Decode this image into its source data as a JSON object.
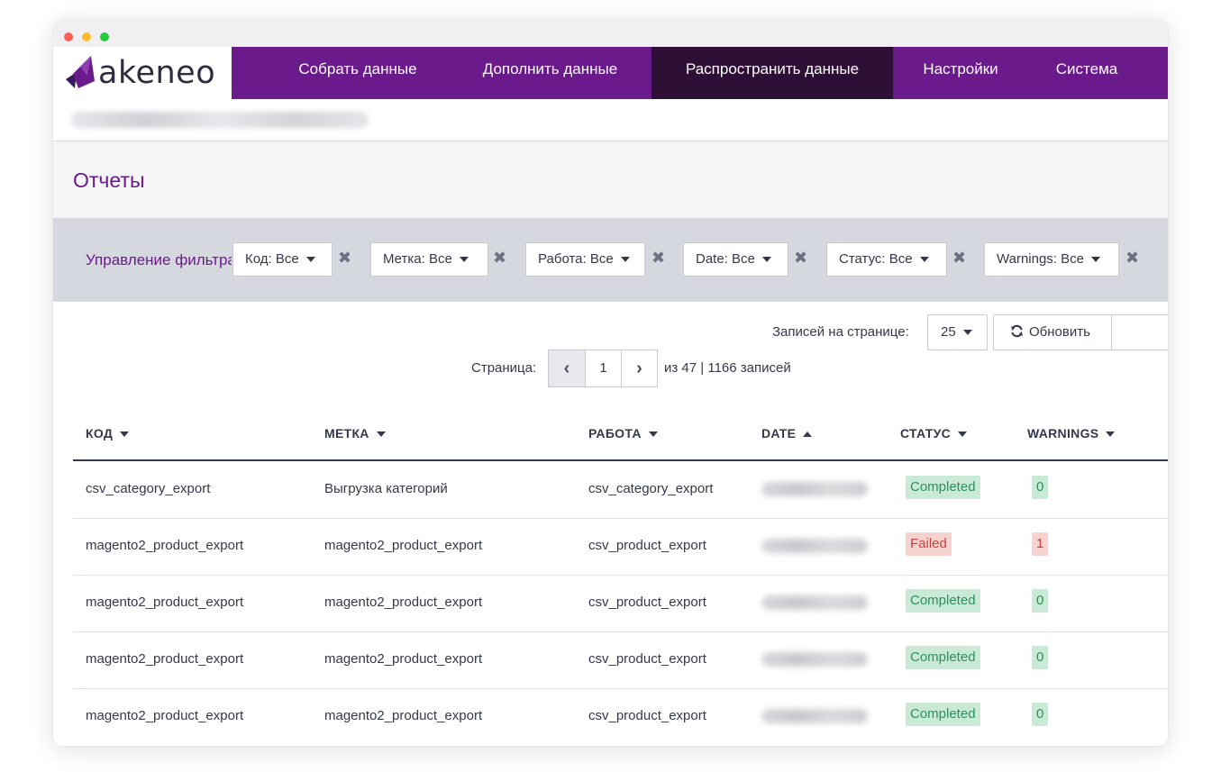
{
  "window": {
    "traffic_lights": [
      "close",
      "minimize",
      "maximize"
    ]
  },
  "logo": {
    "text": "akeneo",
    "color": "#6b1a8c"
  },
  "nav": {
    "items": [
      {
        "label": "Собрать данные",
        "active": false
      },
      {
        "label": "Дополнить данные",
        "active": false
      },
      {
        "label": "Распространить данные",
        "active": true
      },
      {
        "label": "Настройки",
        "active": false
      },
      {
        "label": "Система",
        "active": false
      }
    ]
  },
  "page": {
    "title": "Отчеты"
  },
  "filters": {
    "manage_label": "Управление фильтрами",
    "items": [
      {
        "label": "Код: Все"
      },
      {
        "label": "Метка: Все"
      },
      {
        "label": "Работа: Все"
      },
      {
        "label": "Date: Все"
      },
      {
        "label": "Статус: Все"
      },
      {
        "label": "Warnings: Все"
      }
    ],
    "remove_icon": "✖"
  },
  "toolbar": {
    "per_page_label": "Записей на странице:",
    "per_page_value": "25",
    "refresh_label": "Обновить"
  },
  "pagination": {
    "page_label": "Страница:",
    "current": "1",
    "info": "из 47 | 1166 записей"
  },
  "table": {
    "columns": [
      {
        "label": "КОД",
        "sort": "down"
      },
      {
        "label": "МЕТКА",
        "sort": "down"
      },
      {
        "label": "РАБОТА",
        "sort": "down"
      },
      {
        "label": "DATE",
        "sort": "up"
      },
      {
        "label": "СТАТУС",
        "sort": "down"
      },
      {
        "label": "WARNINGS",
        "sort": "down"
      }
    ],
    "rows": [
      {
        "code": "csv_category_export",
        "label": "Выгрузка категорий",
        "job": "csv_category_export",
        "status": "Completed",
        "status_type": "success",
        "warnings": "0"
      },
      {
        "code": "magento2_product_export",
        "label": "magento2_product_export",
        "job": "csv_product_export",
        "status": "Failed",
        "status_type": "danger",
        "warnings": "1"
      },
      {
        "code": "magento2_product_export",
        "label": "magento2_product_export",
        "job": "csv_product_export",
        "status": "Completed",
        "status_type": "success",
        "warnings": "0"
      },
      {
        "code": "magento2_product_export",
        "label": "magento2_product_export",
        "job": "csv_product_export",
        "status": "Completed",
        "status_type": "success",
        "warnings": "0"
      },
      {
        "code": "magento2_product_export",
        "label": "magento2_product_export",
        "job": "csv_product_export",
        "status": "Completed",
        "status_type": "success",
        "warnings": "0"
      }
    ]
  },
  "colors": {
    "brand": "#6b1a8c",
    "nav_active": "#2e0f35",
    "success": "#2f8f59",
    "danger": "#c9403c"
  }
}
